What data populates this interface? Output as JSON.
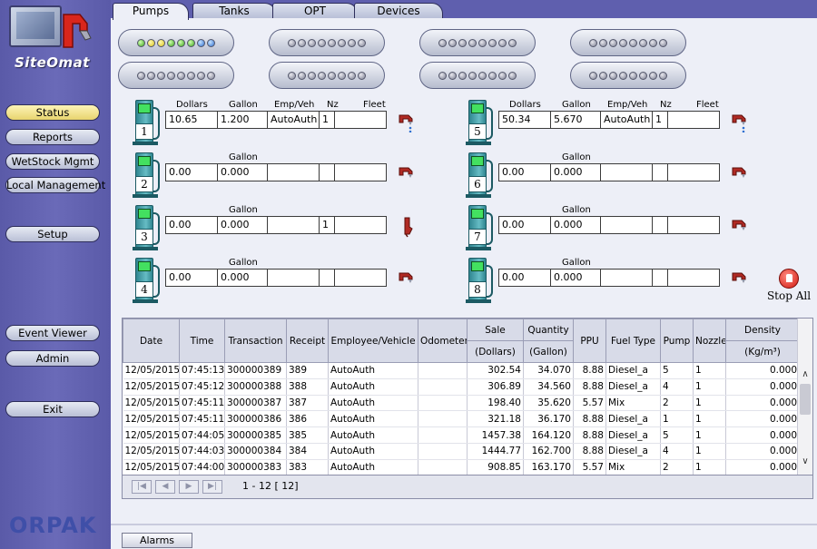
{
  "app": {
    "logo_text": "SiteOmat",
    "brand": "ORPAK"
  },
  "sidebar": {
    "buttons": [
      "Status",
      "Reports",
      "WetStock Mgmt",
      "Local Management",
      "Setup",
      "Event Viewer",
      "Admin",
      "Exit"
    ],
    "active": "Status"
  },
  "tabs": [
    "Pumps",
    "Tanks",
    "OPT",
    "Devices"
  ],
  "active_tab": "Pumps",
  "led_panels": [
    [
      "g",
      "y",
      "y",
      "g",
      "g",
      "g",
      "b",
      "b"
    ],
    [
      "off",
      "off",
      "off",
      "off",
      "off",
      "off",
      "off",
      "off"
    ],
    [
      "off",
      "off",
      "off",
      "off",
      "off",
      "off",
      "off",
      "off"
    ],
    [
      "off",
      "off",
      "off",
      "off",
      "off",
      "off",
      "off",
      "off"
    ],
    [
      "off",
      "off",
      "off",
      "off",
      "off",
      "off",
      "off",
      "off"
    ],
    [
      "off",
      "off",
      "off",
      "off",
      "off",
      "off",
      "off",
      "off"
    ],
    [
      "off",
      "off",
      "off",
      "off",
      "off",
      "off",
      "off",
      "off"
    ],
    [
      "off",
      "off",
      "off",
      "off",
      "off",
      "off",
      "off",
      "off"
    ]
  ],
  "pumps": [
    {
      "num": "1",
      "headers": [
        "Dollars",
        "Gallon",
        "Emp/Veh",
        "Nz",
        "Fleet"
      ],
      "values": [
        "10.65",
        "1.200",
        "AutoAuth",
        "1",
        ""
      ],
      "nozzle": "nozzle-dripping-icon"
    },
    {
      "num": "2",
      "headers": [
        "",
        "Gallon",
        "",
        "",
        ""
      ],
      "values": [
        "0.00",
        "0.000",
        "",
        "",
        ""
      ],
      "nozzle": "nozzle-icon"
    },
    {
      "num": "3",
      "headers": [
        "",
        "Gallon",
        "",
        "",
        ""
      ],
      "values": [
        "0.00",
        "0.000",
        "",
        "1",
        ""
      ],
      "nozzle": "nozzle-lifted-icon"
    },
    {
      "num": "4",
      "headers": [
        "",
        "Gallon",
        "",
        "",
        ""
      ],
      "values": [
        "0.00",
        "0.000",
        "",
        "",
        ""
      ],
      "nozzle": "nozzle-icon"
    },
    {
      "num": "5",
      "headers": [
        "Dollars",
        "Gallon",
        "Emp/Veh",
        "Nz",
        "Fleet"
      ],
      "values": [
        "50.34",
        "5.670",
        "AutoAuth",
        "1",
        ""
      ],
      "nozzle": "nozzle-dripping-icon"
    },
    {
      "num": "6",
      "headers": [
        "",
        "Gallon",
        "",
        "",
        ""
      ],
      "values": [
        "0.00",
        "0.000",
        "",
        "",
        ""
      ],
      "nozzle": "nozzle-icon"
    },
    {
      "num": "7",
      "headers": [
        "",
        "Gallon",
        "",
        "",
        ""
      ],
      "values": [
        "0.00",
        "0.000",
        "",
        "",
        ""
      ],
      "nozzle": "nozzle-icon"
    },
    {
      "num": "8",
      "headers": [
        "",
        "Gallon",
        "",
        "",
        ""
      ],
      "values": [
        "0.00",
        "0.000",
        "",
        "",
        ""
      ],
      "nozzle": "nozzle-icon"
    }
  ],
  "stop_all": "Stop All",
  "table": {
    "headers": [
      "Date",
      "Time",
      "Transaction",
      "Receipt",
      "Employee/Vehicle",
      "Odometer",
      "Sale",
      "Quantity",
      "PPU",
      "Fuel Type",
      "Pump",
      "Nozzle",
      "Density"
    ],
    "sub_headers": [
      "",
      "",
      "",
      "",
      "",
      "",
      "(Dollars)",
      "(Gallon)",
      "",
      "",
      "",
      "",
      "(Kg/m³)"
    ],
    "rows": [
      [
        "12/05/2015",
        "07:45:13",
        "300000389",
        "389",
        "AutoAuth",
        "",
        "302.54",
        "34.070",
        "8.88",
        "Diesel_a",
        "5",
        "1",
        "0.000"
      ],
      [
        "12/05/2015",
        "07:45:12",
        "300000388",
        "388",
        "AutoAuth",
        "",
        "306.89",
        "34.560",
        "8.88",
        "Diesel_a",
        "4",
        "1",
        "0.000"
      ],
      [
        "12/05/2015",
        "07:45:11",
        "300000387",
        "387",
        "AutoAuth",
        "",
        "198.40",
        "35.620",
        "5.57",
        "Mix",
        "2",
        "1",
        "0.000"
      ],
      [
        "12/05/2015",
        "07:45:11",
        "300000386",
        "386",
        "AutoAuth",
        "",
        "321.18",
        "36.170",
        "8.88",
        "Diesel_a",
        "1",
        "1",
        "0.000"
      ],
      [
        "12/05/2015",
        "07:44:05",
        "300000385",
        "385",
        "AutoAuth",
        "",
        "1457.38",
        "164.120",
        "8.88",
        "Diesel_a",
        "5",
        "1",
        "0.000"
      ],
      [
        "12/05/2015",
        "07:44:03",
        "300000384",
        "384",
        "AutoAuth",
        "",
        "1444.77",
        "162.700",
        "8.88",
        "Diesel_a",
        "4",
        "1",
        "0.000"
      ],
      [
        "12/05/2015",
        "07:44:00",
        "300000383",
        "383",
        "AutoAuth",
        "",
        "908.85",
        "163.170",
        "5.57",
        "Mix",
        "2",
        "1",
        "0.000"
      ]
    ],
    "pager_text": "1 - 12  [ 12]"
  },
  "bottom": {
    "alarms": "Alarms"
  }
}
